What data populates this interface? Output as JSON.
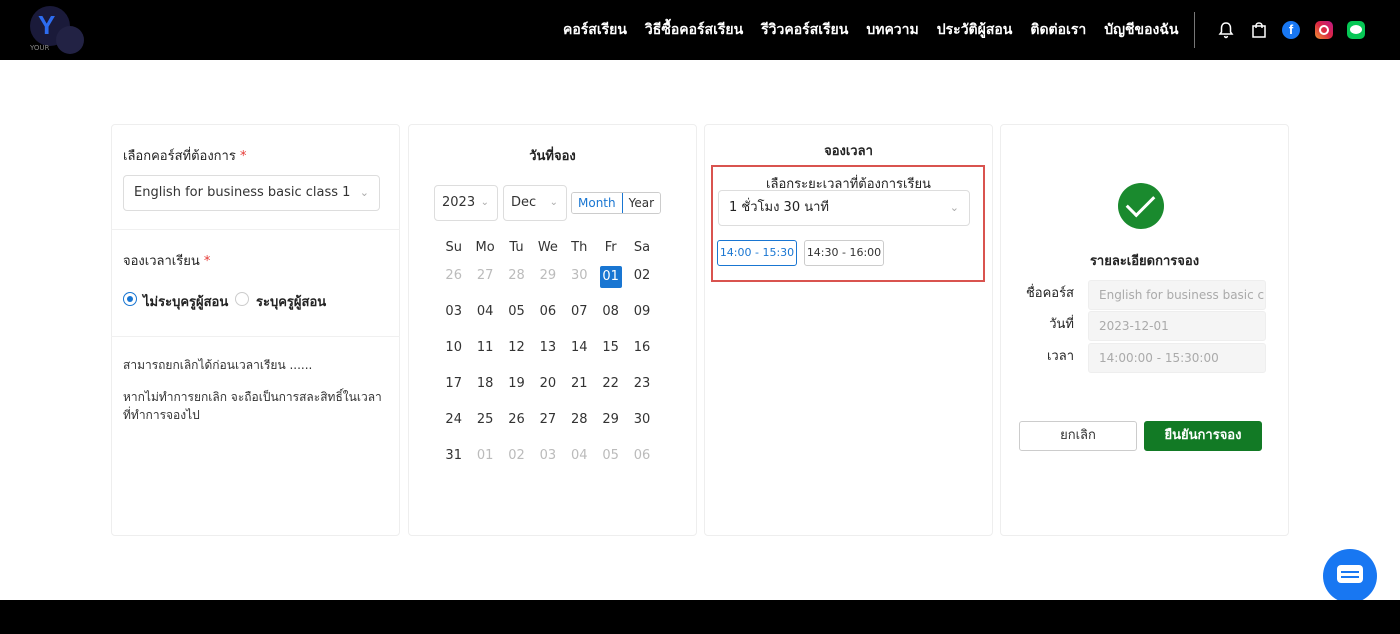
{
  "header": {
    "logo_text": "YOUR",
    "nav": [
      "คอร์สเรียน",
      "วิธีซื้อคอร์สเรียน",
      "รีวิวคอร์สเรียน",
      "บทความ",
      "ประวัติผู้สอน",
      "ติดต่อเรา",
      "บัญชีของฉัน"
    ],
    "facebook_glyph": "f"
  },
  "course": {
    "label": "เลือกคอร์สที่ต้องการ",
    "required": "*",
    "selected": "English for business basic class 1",
    "book_label": "จองเวลาเรียน",
    "radio_no_teacher": "ไม่ระบุครูผู้สอน",
    "radio_teacher": "ระบุครูผู้สอน",
    "note1": "สามารถยกเลิกได้ก่อนเวลาเรียน ......",
    "note2": "หากไม่ทำการยกเลิก จะถือเป็นการสละสิทธิ์ในเวลา ที่ทำการจองไป"
  },
  "calendar": {
    "title": "วันที่จอง",
    "year": "2023",
    "month": "Dec",
    "mode_month": "Month",
    "mode_year": "Year",
    "weekdays": [
      "Su",
      "Mo",
      "Tu",
      "We",
      "Th",
      "Fr",
      "Sa"
    ],
    "weeks": [
      [
        "26",
        "27",
        "28",
        "29",
        "30",
        "01",
        "02"
      ],
      [
        "03",
        "04",
        "05",
        "06",
        "07",
        "08",
        "09"
      ],
      [
        "10",
        "11",
        "12",
        "13",
        "14",
        "15",
        "16"
      ],
      [
        "17",
        "18",
        "19",
        "20",
        "21",
        "22",
        "23"
      ],
      [
        "24",
        "25",
        "26",
        "27",
        "28",
        "29",
        "30"
      ],
      [
        "31",
        "01",
        "02",
        "03",
        "04",
        "05",
        "06"
      ]
    ],
    "selected": "01"
  },
  "time": {
    "title": "จองเวลา",
    "duration_label": "เลือกระยะเวลาที่ต้องการเรียน",
    "duration": "1 ชั่วโมง 30 นาที",
    "slots": [
      "14:00 - 15:30",
      "14:30 - 16:00"
    ]
  },
  "details": {
    "title": "รายละเอียดการจอง",
    "course_label": "ชื่อคอร์ส",
    "course_value": "English for business basic cl",
    "date_label": "วันที่",
    "date_value": "2023-12-01",
    "time_label": "เวลา",
    "time_value": "14:00:00 - 15:30:00",
    "cancel": "ยกเลิก",
    "confirm": "ยืนยันการจอง"
  },
  "icons": [
    "bell-icon",
    "bag-icon",
    "facebook-icon",
    "instagram-icon",
    "line-icon",
    "check-circle-icon",
    "chat-icon"
  ],
  "colors": {
    "accent": "#1976d2",
    "success": "#127a25",
    "highlight": "#d9534f"
  }
}
